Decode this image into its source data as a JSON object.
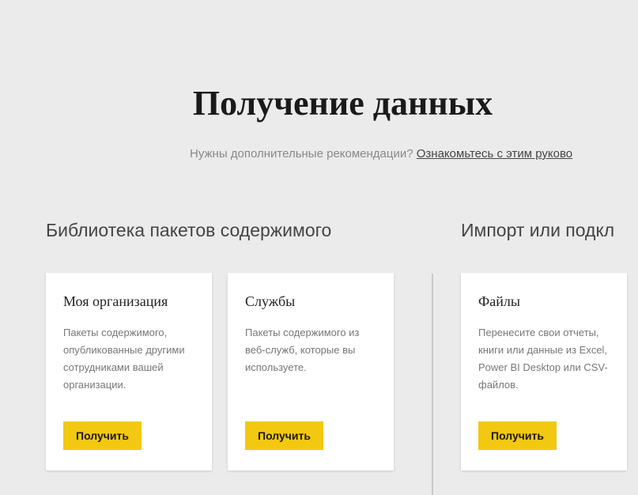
{
  "header": {
    "title": "Получение данных",
    "subtitle_text": "Нужны дополнительные рекомендации? ",
    "subtitle_link": "Ознакомьтесь с этим руково"
  },
  "sections": {
    "left": {
      "heading": "Библиотека пакетов содержимого",
      "cards": [
        {
          "title": "Моя организация",
          "desc": "Пакеты содержимого, опубликованные другими сотрудниками вашей организации.",
          "button": "Получить"
        },
        {
          "title": "Службы",
          "desc": "Пакеты содержимого из веб-служб, которые вы используете.",
          "button": "Получить"
        }
      ]
    },
    "right": {
      "heading": "Импорт или подкл",
      "cards": [
        {
          "title": "Файлы",
          "desc": "Перенесите свои отчеты, книги или данные из Excel, Power BI Desktop или CSV-файлов.",
          "button": "Получить"
        }
      ]
    }
  }
}
